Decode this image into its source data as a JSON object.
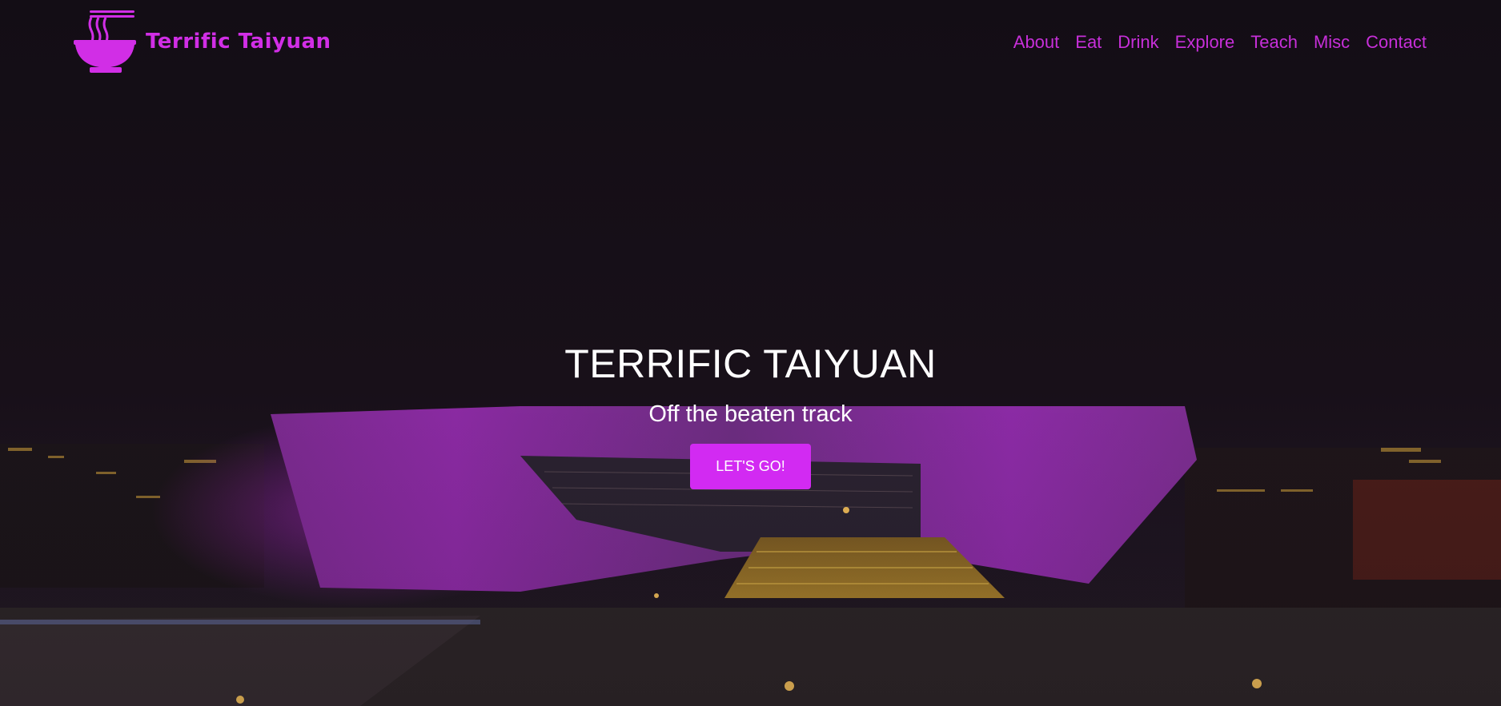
{
  "site": {
    "logo_text": "Terrific Taiyuan",
    "logo_icon": "noodle-bowl-icon"
  },
  "nav": {
    "items": [
      {
        "label": "About"
      },
      {
        "label": "Eat"
      },
      {
        "label": "Drink"
      },
      {
        "label": "Explore"
      },
      {
        "label": "Teach"
      },
      {
        "label": "Misc"
      },
      {
        "label": "Contact"
      }
    ]
  },
  "hero": {
    "title": "TERRIFIC TAIYUAN",
    "subtitle": "Off the beaten track",
    "cta_label": "LET'S GO!"
  },
  "colors": {
    "accent": "#d22af2",
    "nav_link": "#c72fd9",
    "background": "#120d14",
    "text": "#ffffff"
  }
}
